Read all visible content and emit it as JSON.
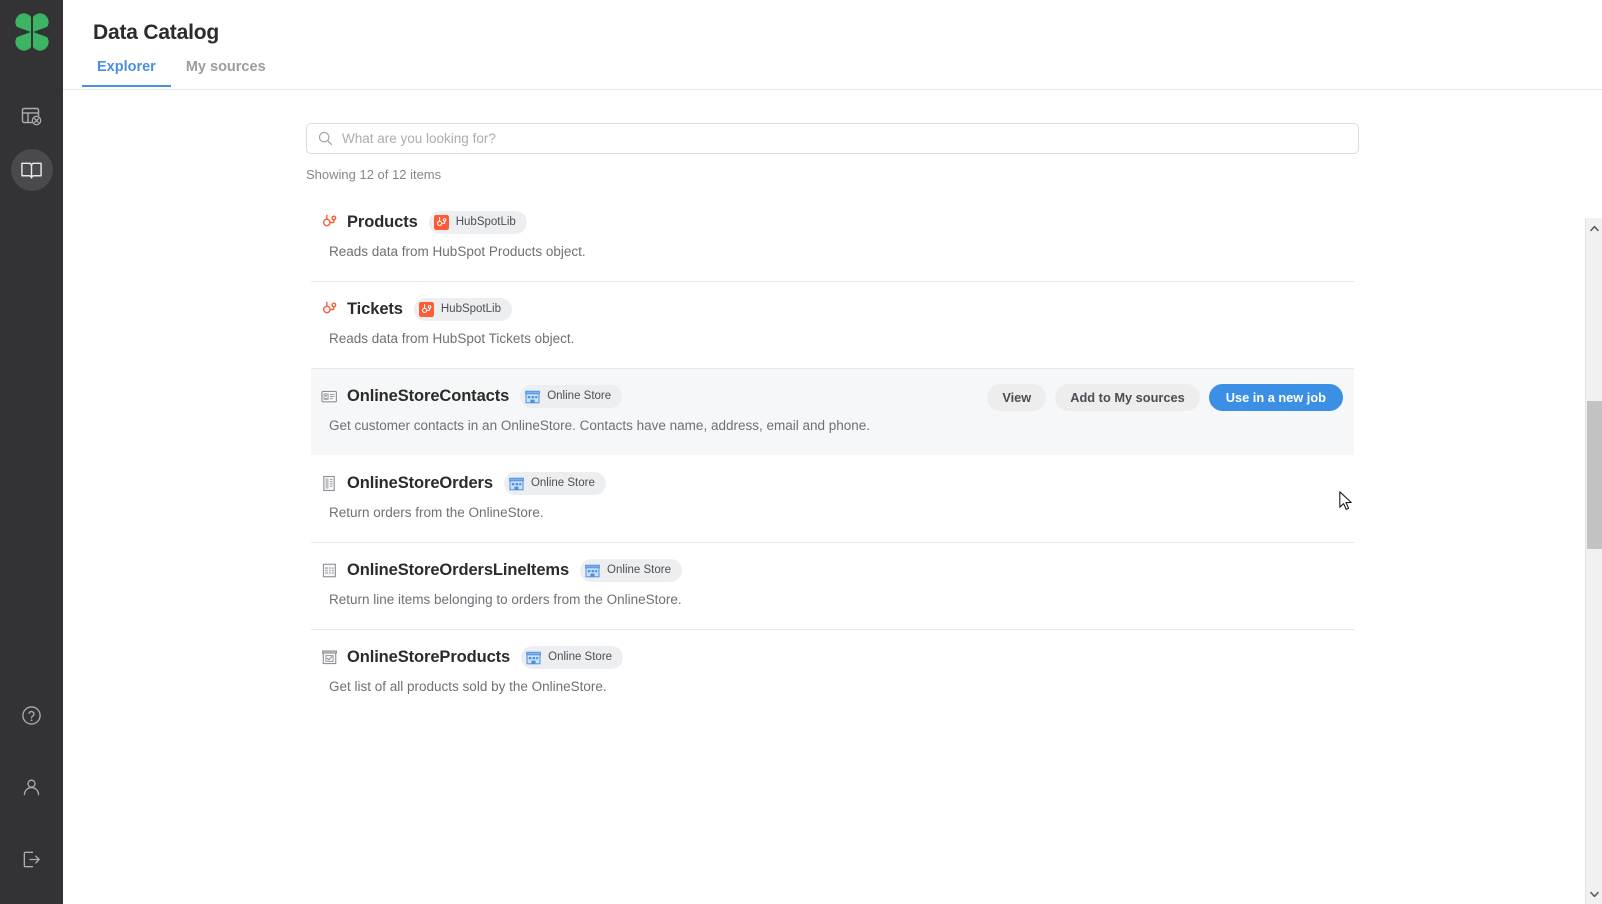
{
  "app": {
    "logo_icon": "clover-logo-icon",
    "brand_color": "#3cb464"
  },
  "sidebar": {
    "items": [
      {
        "icon": "table-clover-icon",
        "name": "jobs",
        "active": false
      },
      {
        "icon": "open-book-icon",
        "name": "data-catalog",
        "active": true
      }
    ],
    "bottom_items": [
      {
        "icon": "help-circle-icon",
        "name": "help"
      },
      {
        "icon": "user-icon",
        "name": "account"
      },
      {
        "icon": "logout-icon",
        "name": "logout"
      }
    ]
  },
  "header": {
    "title": "Data Catalog"
  },
  "tabs": [
    {
      "label": "Explorer",
      "active": true
    },
    {
      "label": "My sources",
      "active": false
    }
  ],
  "search": {
    "placeholder": "What are you looking for?",
    "value": "",
    "icon": "search-icon"
  },
  "results_summary": "Showing 12 of 12 items",
  "actions": {
    "view": "View",
    "add_to_my_sources": "Add to My sources",
    "use_in_new_job": "Use in a new job",
    "primary_color": "#3b90e5"
  },
  "items": [
    {
      "title": "Products",
      "icon": "hubspot-sprocket-icon",
      "badge": {
        "label": "HubSpotLib",
        "icon": "hubspot-square-icon"
      },
      "description": "Reads data from HubSpot Products object.",
      "highlight": false
    },
    {
      "title": "Tickets",
      "icon": "hubspot-sprocket-icon",
      "badge": {
        "label": "HubSpotLib",
        "icon": "hubspot-square-icon"
      },
      "description": "Reads data from HubSpot Tickets object.",
      "highlight": false
    },
    {
      "title": "OnlineStoreContacts",
      "icon": "contact-card-icon",
      "badge": {
        "label": "Online Store",
        "icon": "store-building-icon"
      },
      "description": "Get customer contacts in an OnlineStore. Contacts have name, address, email and phone.",
      "highlight": true
    },
    {
      "title": "OnlineStoreOrders",
      "icon": "order-document-icon",
      "badge": {
        "label": "Online Store",
        "icon": "store-building-icon"
      },
      "description": "Return orders from the OnlineStore.",
      "highlight": false
    },
    {
      "title": "OnlineStoreOrdersLineItems",
      "icon": "line-items-icon",
      "badge": {
        "label": "Online Store",
        "icon": "store-building-icon"
      },
      "description": "Return line items belonging to orders from the OnlineStore.",
      "highlight": false
    },
    {
      "title": "OnlineStoreProducts",
      "icon": "product-box-icon",
      "badge": {
        "label": "Online Store",
        "icon": "store-building-icon"
      },
      "description": "Get list of all products sold by the OnlineStore.",
      "highlight": false
    }
  ],
  "scrollbar": {
    "up_arrow_icon": "chevron-up-icon",
    "down_arrow_icon": "chevron-down-icon"
  }
}
